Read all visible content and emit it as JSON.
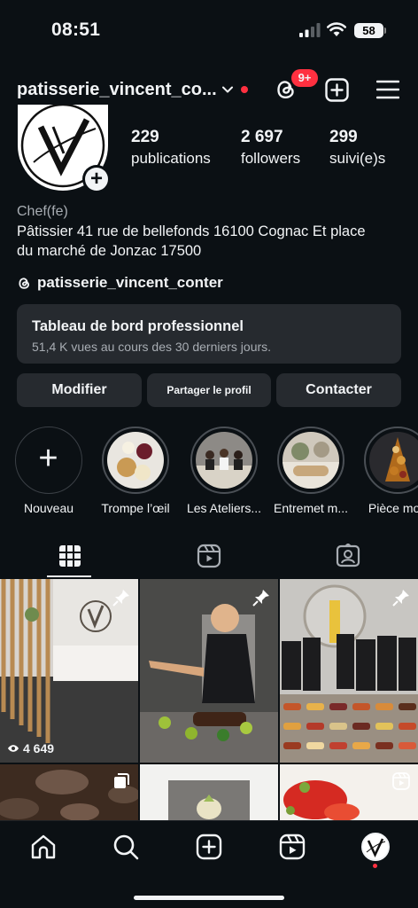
{
  "status_bar": {
    "time": "08:51",
    "battery": "58"
  },
  "header": {
    "username": "patisserie_vincent_co...",
    "notification_badge": "9+"
  },
  "profile": {
    "stats": [
      {
        "number": "229",
        "label": "publications"
      },
      {
        "number": "2 697",
        "label": "followers"
      },
      {
        "number": "299",
        "label": "suivi(e)s"
      }
    ],
    "category": "Chef(fe)",
    "bio_line1": "Pâtissier 41 rue de bellefonds 16100 Cognac Et place",
    "bio_line2": "du marché de Jonzac 17500",
    "threads_handle": "patisserie_vincent_conter"
  },
  "dashboard": {
    "title": "Tableau de bord professionnel",
    "subtitle": "51,4 K vues au cours des 30 derniers jours."
  },
  "buttons": {
    "edit": "Modifier",
    "share": "Partager le profil",
    "contact": "Contacter"
  },
  "highlights": [
    {
      "label": "Nouveau"
    },
    {
      "label": "Trompe l’œil"
    },
    {
      "label": "Les Ateliers..."
    },
    {
      "label": "Entremet m..."
    },
    {
      "label": "Pièce mon"
    }
  ],
  "grid": {
    "first_post_views": "4 649"
  },
  "colors": {
    "background": "#0b1014",
    "surface": "#262a2f",
    "accent_red": "#ff3040",
    "text": "#f2f4f6",
    "muted": "#a8adb3"
  }
}
